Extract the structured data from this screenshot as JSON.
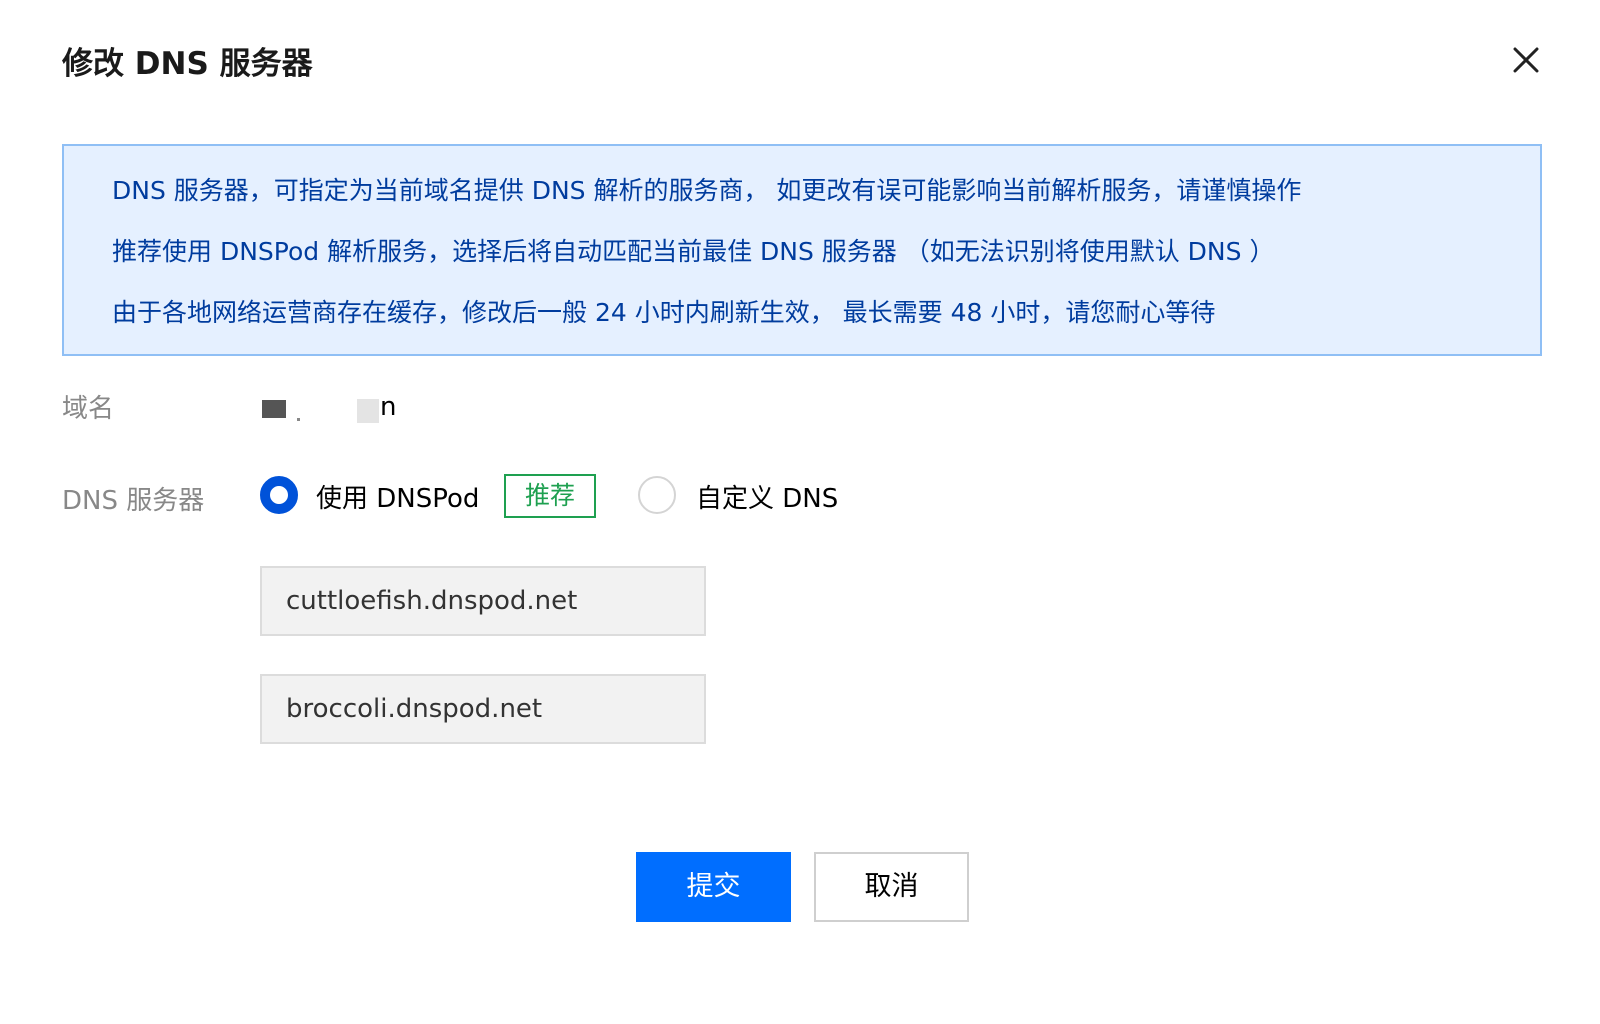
{
  "dialog": {
    "title": "修改 DNS 服务器"
  },
  "notice": {
    "lines": [
      "DNS 服务器，可指定为当前域名提供 DNS 解析的服务商， 如更改有误可能影响当前解析服务，请谨慎操作",
      "推荐使用 DNSPod 解析服务，选择后将自动匹配当前最佳 DNS 服务器 （如无法识别将使用默认 DNS ）",
      "由于各地网络运营商存在缓存，修改后一般 24 小时内刷新生效， 最长需要 48 小时，请您耐心等待"
    ]
  },
  "form": {
    "domain_label": "域名",
    "domain_value_visible": "n",
    "dns_label": "DNS 服务器",
    "options": [
      {
        "label": "使用 DNSPod",
        "checked": true,
        "tag": "推荐"
      },
      {
        "label": "自定义 DNS",
        "checked": false
      }
    ],
    "nameservers": [
      "cuttloefish.dnspod.net",
      "broccoli.dnspod.net"
    ]
  },
  "footer": {
    "submit_label": "提交",
    "cancel_label": "取消"
  },
  "colors": {
    "primary": "#006eff",
    "radio_checked": "#0052d9",
    "notice_bg": "#e5f0ff",
    "notice_border": "#8fbff5",
    "notice_text": "#003c9e",
    "tag_green": "#1ea050"
  },
  "icons": {
    "close": "close-icon"
  }
}
